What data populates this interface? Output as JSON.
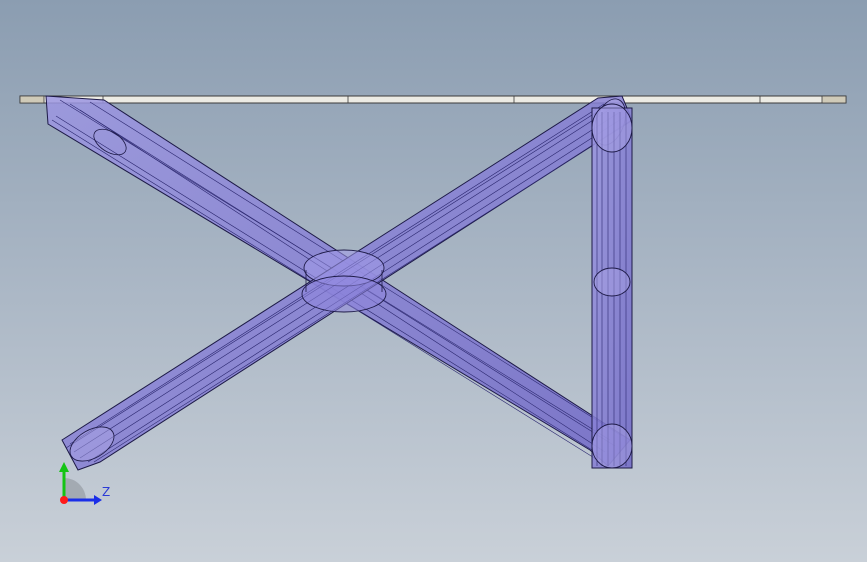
{
  "viewport": {
    "background_top": "#8b9db1",
    "background_bottom": "#c9d0d8"
  },
  "model": {
    "tabletop_fill": "#ecebe4",
    "tabletop_edge": "#3a3a3a",
    "leg_fill": "#8a82d8",
    "leg_edge": "#1d1a47"
  },
  "triad": {
    "z_label": "Z",
    "x_color": "#ff1a1a",
    "y_color": "#14c414",
    "z_color": "#1a2ee8"
  }
}
